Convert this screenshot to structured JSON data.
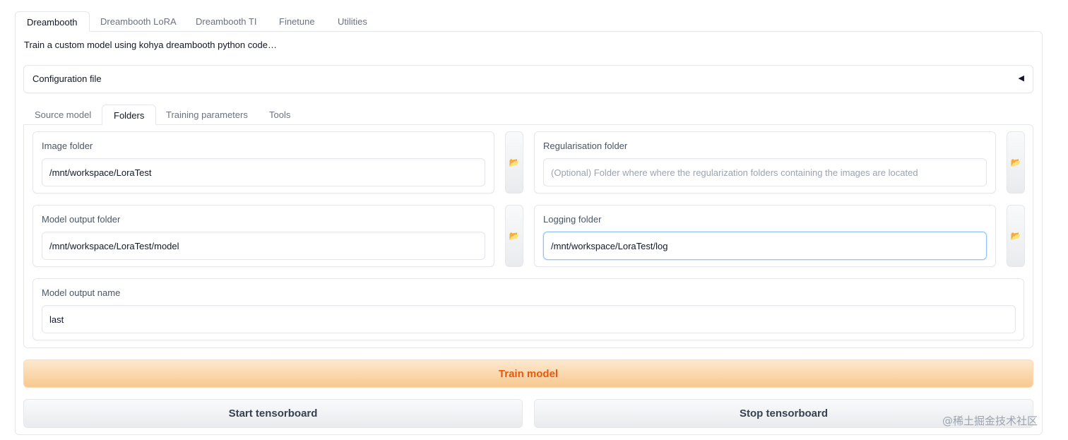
{
  "top_tabs": [
    {
      "label": "Dreambooth",
      "active": true
    },
    {
      "label": "Dreambooth LoRA",
      "active": false
    },
    {
      "label": "Dreambooth TI",
      "active": false
    },
    {
      "label": "Finetune",
      "active": false
    },
    {
      "label": "Utilities",
      "active": false
    }
  ],
  "description": "Train a custom model using kohya dreambooth python code…",
  "config_section": {
    "label": "Configuration file",
    "icon": "collapse-arrow-icon",
    "arrow": "◀"
  },
  "sub_tabs": [
    {
      "label": "Source model",
      "active": false
    },
    {
      "label": "Folders",
      "active": true
    },
    {
      "label": "Training parameters",
      "active": false
    },
    {
      "label": "Tools",
      "active": false
    }
  ],
  "fields": {
    "image_folder": {
      "label": "Image folder",
      "value": "/mnt/workspace/LoraTest",
      "placeholder": ""
    },
    "reg_folder": {
      "label": "Regularisation folder",
      "value": "",
      "placeholder": "(Optional) Folder where where the regularization folders containing the images are located"
    },
    "model_output_folder": {
      "label": "Model output folder",
      "value": "/mnt/workspace/LoraTest/model",
      "placeholder": ""
    },
    "logging_folder": {
      "label": "Logging folder",
      "value": "/mnt/workspace/LoraTest/log",
      "placeholder": ""
    },
    "model_output_name": {
      "label": "Model output name",
      "value": "last",
      "placeholder": ""
    }
  },
  "folder_button_icon": "📂",
  "buttons": {
    "train": "Train model",
    "start_tensorboard": "Start tensorboard",
    "stop_tensorboard": "Stop tensorboard"
  },
  "watermark": "@稀土掘金技术社区",
  "colors": {
    "train_text": "#ea580c",
    "train_bg_top": "#fde8cf",
    "train_bg_bottom": "#f8c98f",
    "focus_border": "#93c5fd"
  }
}
